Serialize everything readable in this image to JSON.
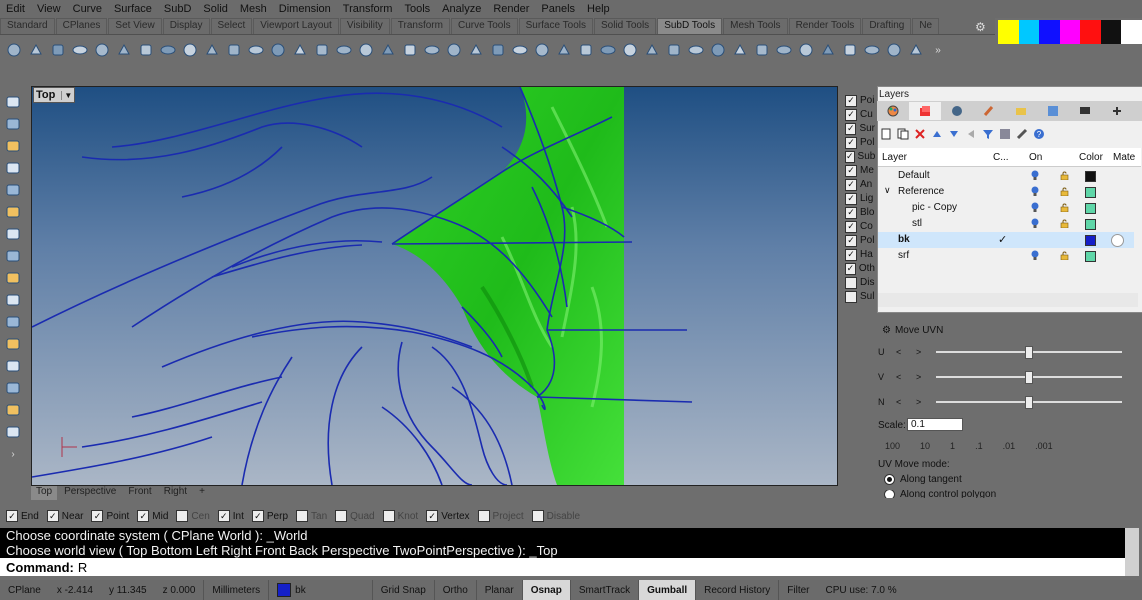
{
  "menu": [
    "Edit",
    "View",
    "Curve",
    "Surface",
    "SubD",
    "Solid",
    "Mesh",
    "Dimension",
    "Transform",
    "Tools",
    "Analyze",
    "Render",
    "Panels",
    "Help"
  ],
  "toolbar_tabs": [
    "Standard",
    "CPlanes",
    "Set View",
    "Display",
    "Select",
    "Viewport Layout",
    "Visibility",
    "Transform",
    "Curve Tools",
    "Surface Tools",
    "Solid Tools",
    "SubD Tools",
    "Mesh Tools",
    "Render Tools",
    "Drafting",
    "Ne"
  ],
  "active_toolbar_tab": "SubD Tools",
  "swatch_colors": [
    "#ffff00",
    "#00c8ff",
    "#1010ff",
    "#ff00ff",
    "#ff1010",
    "#111111",
    "#ffffff"
  ],
  "viewport": {
    "title": "Top",
    "tabs": [
      "Top",
      "Perspective",
      "Front",
      "Right",
      "+"
    ],
    "active_tab": "Top",
    "gradient_top": "#1f4f83",
    "surface_color": "#22c21c",
    "curve_color": "#1a2bb0"
  },
  "osnap": [
    {
      "label": "End",
      "checked": true
    },
    {
      "label": "Near",
      "checked": true
    },
    {
      "label": "Point",
      "checked": true
    },
    {
      "label": "Mid",
      "checked": true
    },
    {
      "label": "Cen",
      "checked": false
    },
    {
      "label": "Int",
      "checked": true
    },
    {
      "label": "Perp",
      "checked": true
    },
    {
      "label": "Tan",
      "checked": false
    },
    {
      "label": "Quad",
      "checked": false
    },
    {
      "label": "Knot",
      "checked": false
    },
    {
      "label": "Vertex",
      "checked": true
    },
    {
      "label": "Project",
      "checked": false
    },
    {
      "label": "Disable",
      "checked": false
    }
  ],
  "command": {
    "history": [
      "Choose coordinate system ( CPlane  World ): _World",
      "Choose world view ( Top  Bottom  Left  Right  Front  Back  Perspective  TwoPointPerspective ): _Top"
    ],
    "prompt": "Command:",
    "input": "R"
  },
  "status": {
    "cplane": "CPlane",
    "x": "x -2.414",
    "y": "y 11.345",
    "z": "z 0.000",
    "units": "Millimeters",
    "layer": "bk",
    "layer_color": "#1520c8",
    "buttons": [
      {
        "label": "Grid Snap",
        "on": false
      },
      {
        "label": "Ortho",
        "on": false
      },
      {
        "label": "Planar",
        "on": false
      },
      {
        "label": "Osnap",
        "on": true
      },
      {
        "label": "SmartTrack",
        "on": false
      },
      {
        "label": "Gumball",
        "on": true
      },
      {
        "label": "Record History",
        "on": false
      },
      {
        "label": "Filter",
        "on": false
      }
    ],
    "cpu": "CPU use: 7.0 %"
  },
  "object_filters": [
    {
      "label": "Poi",
      "checked": true
    },
    {
      "label": "Cu",
      "checked": true
    },
    {
      "label": "Sur",
      "checked": true
    },
    {
      "label": "Pol",
      "checked": true
    },
    {
      "label": "Sub",
      "checked": true
    },
    {
      "label": "Me",
      "checked": true
    },
    {
      "label": "An",
      "checked": true
    },
    {
      "label": "Lig",
      "checked": true
    },
    {
      "label": "Blo",
      "checked": true
    },
    {
      "label": "Co",
      "checked": true
    },
    {
      "label": "Pol",
      "checked": true
    },
    {
      "label": "Ha",
      "checked": true
    },
    {
      "label": "Oth",
      "checked": true
    },
    {
      "label": "Dis",
      "checked": false
    },
    {
      "label": "Sul",
      "checked": false
    }
  ],
  "layers": {
    "panel_title": "Layers",
    "headers": {
      "layer": "Layer",
      "current": "C...",
      "on": "On",
      "color": "Color",
      "material": "Mate"
    },
    "rows": [
      {
        "name": "Default",
        "color": "#111111",
        "current": "",
        "selected": false,
        "indent": 0
      },
      {
        "name": "Reference",
        "color": "#5fd6a8",
        "current": "",
        "selected": false,
        "indent": 0
      },
      {
        "name": "pic - Copy",
        "color": "#5fd6a8",
        "current": "",
        "selected": false,
        "indent": 2
      },
      {
        "name": "stl",
        "color": "#5fd6a8",
        "current": "",
        "selected": false,
        "indent": 2
      },
      {
        "name": "bk",
        "color": "#1520c8",
        "current": "✓",
        "selected": true,
        "indent": 0
      },
      {
        "name": "srf",
        "color": "#5fd6a8",
        "current": "",
        "selected": false,
        "indent": 0
      }
    ],
    "expander": "∨"
  },
  "move_uvn": {
    "title": "Move UVN",
    "rows": [
      {
        "axis": "U",
        "value": 0.5
      },
      {
        "axis": "V",
        "value": 0.5
      },
      {
        "axis": "N",
        "value": 0.5
      }
    ],
    "lt": "<",
    "gt": ">",
    "scale_label": "Scale:",
    "scale_value": "0.1",
    "scale_presets": [
      "100",
      "10",
      "1",
      ".1",
      ".01",
      ".001"
    ],
    "uv_move_label": "UV Move mode:",
    "options": [
      {
        "label": "Along tangent",
        "selected": true
      },
      {
        "label": "Along control polygon",
        "selected": false
      }
    ]
  }
}
